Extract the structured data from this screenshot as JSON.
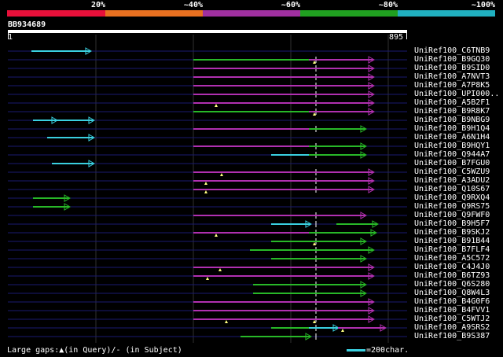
{
  "legend": {
    "labels": [
      "20%",
      "~40%",
      "~60%",
      "~80%",
      "~100%"
    ],
    "colors": [
      "#e8103a",
      "#e87020",
      "#a030a0",
      "#20a020",
      "#20b0c0"
    ]
  },
  "query": {
    "id": "BB934689",
    "start": "1",
    "end": "895"
  },
  "colors": {
    "cyan": "#3ad0e0",
    "green": "#28b828",
    "magenta": "#b030b0",
    "guide": "#1a1a70",
    "grid": "#303030",
    "gap": "#ffff80"
  },
  "hits": [
    {
      "label": "UniRef100_C6TNB9",
      "segs": [
        [
          40,
          115,
          "cyan",
          "e"
        ]
      ],
      "gaps": []
    },
    {
      "label": "UniRef100_B9GQ30",
      "segs": [
        [
          246,
          393,
          "green",
          ""
        ],
        [
          393,
          475,
          "magenta",
          "e"
        ]
      ],
      "gaps": [
        400
      ]
    },
    {
      "label": "UniRef100_B9SID0",
      "segs": [
        [
          246,
          393,
          "magenta",
          ""
        ],
        [
          393,
          475,
          "magenta",
          "e"
        ]
      ],
      "gaps": []
    },
    {
      "label": "UniRef100_A7NVT3",
      "segs": [
        [
          246,
          393,
          "magenta",
          ""
        ],
        [
          393,
          475,
          "magenta",
          "e"
        ]
      ],
      "gaps": []
    },
    {
      "label": "UniRef100_A7P8K5",
      "segs": [
        [
          246,
          393,
          "magenta",
          ""
        ],
        [
          393,
          475,
          "magenta",
          "e"
        ]
      ],
      "gaps": []
    },
    {
      "label": "UniRef100_UPI000..",
      "segs": [
        [
          246,
          393,
          "magenta",
          ""
        ],
        [
          393,
          475,
          "magenta",
          "e"
        ]
      ],
      "gaps": []
    },
    {
      "label": "UniRef100_A5B2F1",
      "segs": [
        [
          246,
          393,
          "magenta",
          ""
        ],
        [
          393,
          475,
          "magenta",
          "e"
        ]
      ],
      "gaps": [
        275
      ]
    },
    {
      "label": "UniRef100_B9R8K7",
      "segs": [
        [
          246,
          393,
          "green",
          ""
        ],
        [
          393,
          475,
          "magenta",
          "e"
        ]
      ],
      "gaps": [
        400
      ]
    },
    {
      "label": "UniRef100_B9NBG9",
      "segs": [
        [
          42,
          119,
          "cyan",
          "b"
        ]
      ],
      "gaps": []
    },
    {
      "label": "UniRef100_B9H1Q4",
      "segs": [
        [
          246,
          393,
          "magenta",
          ""
        ],
        [
          393,
          465,
          "green",
          "e"
        ]
      ],
      "gaps": []
    },
    {
      "label": "UniRef100_A6N1H4",
      "segs": [
        [
          60,
          119,
          "cyan",
          "e"
        ]
      ],
      "gaps": []
    },
    {
      "label": "UniRef100_B9HQY1",
      "segs": [
        [
          246,
          393,
          "magenta",
          ""
        ],
        [
          393,
          465,
          "green",
          "e"
        ]
      ],
      "gaps": []
    },
    {
      "label": "UniRef100_Q944A7",
      "segs": [
        [
          345,
          393,
          "cyan",
          ""
        ],
        [
          393,
          465,
          "green",
          "e"
        ]
      ],
      "gaps": []
    },
    {
      "label": "UniRef100_B7FGU0",
      "segs": [
        [
          66,
          119,
          "cyan",
          "e"
        ]
      ],
      "gaps": []
    },
    {
      "label": "UniRef100_C5WZU9",
      "segs": [
        [
          246,
          393,
          "magenta",
          ""
        ],
        [
          393,
          475,
          "magenta",
          "e"
        ]
      ],
      "gaps": [
        282
      ]
    },
    {
      "label": "UniRef100_A3ADU2",
      "segs": [
        [
          246,
          393,
          "magenta",
          ""
        ],
        [
          393,
          475,
          "magenta",
          "e"
        ]
      ],
      "gaps": [
        262
      ]
    },
    {
      "label": "UniRef100_Q10S67",
      "segs": [
        [
          246,
          393,
          "magenta",
          ""
        ],
        [
          393,
          475,
          "magenta",
          "e"
        ]
      ],
      "gaps": [
        262
      ]
    },
    {
      "label": "UniRef100_Q9RXQ4",
      "segs": [
        [
          42,
          88,
          "green",
          "e"
        ]
      ],
      "gaps": []
    },
    {
      "label": "UniRef100_Q9RS75",
      "segs": [
        [
          42,
          88,
          "green",
          "e"
        ]
      ],
      "gaps": []
    },
    {
      "label": "UniRef100_Q9FWF0",
      "segs": [
        [
          246,
          393,
          "magenta",
          ""
        ],
        [
          393,
          465,
          "magenta",
          "e"
        ]
      ],
      "gaps": []
    },
    {
      "label": "UniRef100_B9H5F7",
      "segs": [
        [
          345,
          393,
          "cyan",
          ""
        ],
        [
          393,
          395,
          "cyan",
          "e"
        ],
        [
          428,
          480,
          "green",
          "e"
        ]
      ],
      "gaps": []
    },
    {
      "label": "UniRef100_B9SKJ2",
      "segs": [
        [
          246,
          393,
          "magenta",
          ""
        ],
        [
          393,
          478,
          "green",
          "e"
        ]
      ],
      "gaps": [
        275
      ]
    },
    {
      "label": "UniRef100_B91B44",
      "segs": [
        [
          345,
          393,
          "green",
          ""
        ],
        [
          393,
          465,
          "green",
          "e"
        ]
      ],
      "gaps": [
        400
      ]
    },
    {
      "label": "UniRef100_B7FLF4",
      "segs": [
        [
          318,
          393,
          "green",
          ""
        ],
        [
          393,
          475,
          "green",
          "e"
        ]
      ],
      "gaps": []
    },
    {
      "label": "UniRef100_A5C572",
      "segs": [
        [
          345,
          393,
          "green",
          ""
        ],
        [
          393,
          465,
          "green",
          "e"
        ]
      ],
      "gaps": []
    },
    {
      "label": "UniRef100_C4J4J0",
      "segs": [
        [
          246,
          393,
          "magenta",
          ""
        ],
        [
          393,
          475,
          "magenta",
          "e"
        ]
      ],
      "gaps": [
        280
      ]
    },
    {
      "label": "UniRef100_B6TZ93",
      "segs": [
        [
          246,
          393,
          "magenta",
          ""
        ],
        [
          393,
          475,
          "magenta",
          "e"
        ]
      ],
      "gaps": [
        264
      ]
    },
    {
      "label": "UniRef100_Q6S280",
      "segs": [
        [
          322,
          393,
          "green",
          ""
        ],
        [
          393,
          465,
          "green",
          "e"
        ]
      ],
      "gaps": []
    },
    {
      "label": "UniRef100_Q8W4L3",
      "segs": [
        [
          322,
          393,
          "green",
          ""
        ],
        [
          393,
          465,
          "green",
          "e"
        ]
      ],
      "gaps": []
    },
    {
      "label": "UniRef100_B4G0F6",
      "segs": [
        [
          246,
          393,
          "magenta",
          ""
        ],
        [
          393,
          475,
          "magenta",
          "e"
        ]
      ],
      "gaps": []
    },
    {
      "label": "UniRef100_B4FVV1",
      "segs": [
        [
          246,
          393,
          "magenta",
          ""
        ],
        [
          393,
          475,
          "magenta",
          "e"
        ]
      ],
      "gaps": []
    },
    {
      "label": "UniRef100_C5WTJ2",
      "segs": [
        [
          246,
          393,
          "magenta",
          ""
        ],
        [
          393,
          475,
          "magenta",
          "e"
        ]
      ],
      "gaps": [
        288,
        400
      ]
    },
    {
      "label": "UniRef100_A9SRS2",
      "segs": [
        [
          345,
          393,
          "green",
          ""
        ],
        [
          393,
          430,
          "cyan",
          "e"
        ],
        [
          430,
          490,
          "magenta",
          "e"
        ]
      ],
      "gaps": [
        436
      ]
    },
    {
      "label": "UniRef100_B9S387",
      "segs": [
        [
          306,
          393,
          "green",
          ""
        ],
        [
          393,
          395,
          "green",
          "e"
        ]
      ],
      "gaps": []
    }
  ],
  "footer": {
    "gaps_text": "Large gaps:▲(in Query)/- (in Subject)",
    "scale_text": "=200char."
  }
}
